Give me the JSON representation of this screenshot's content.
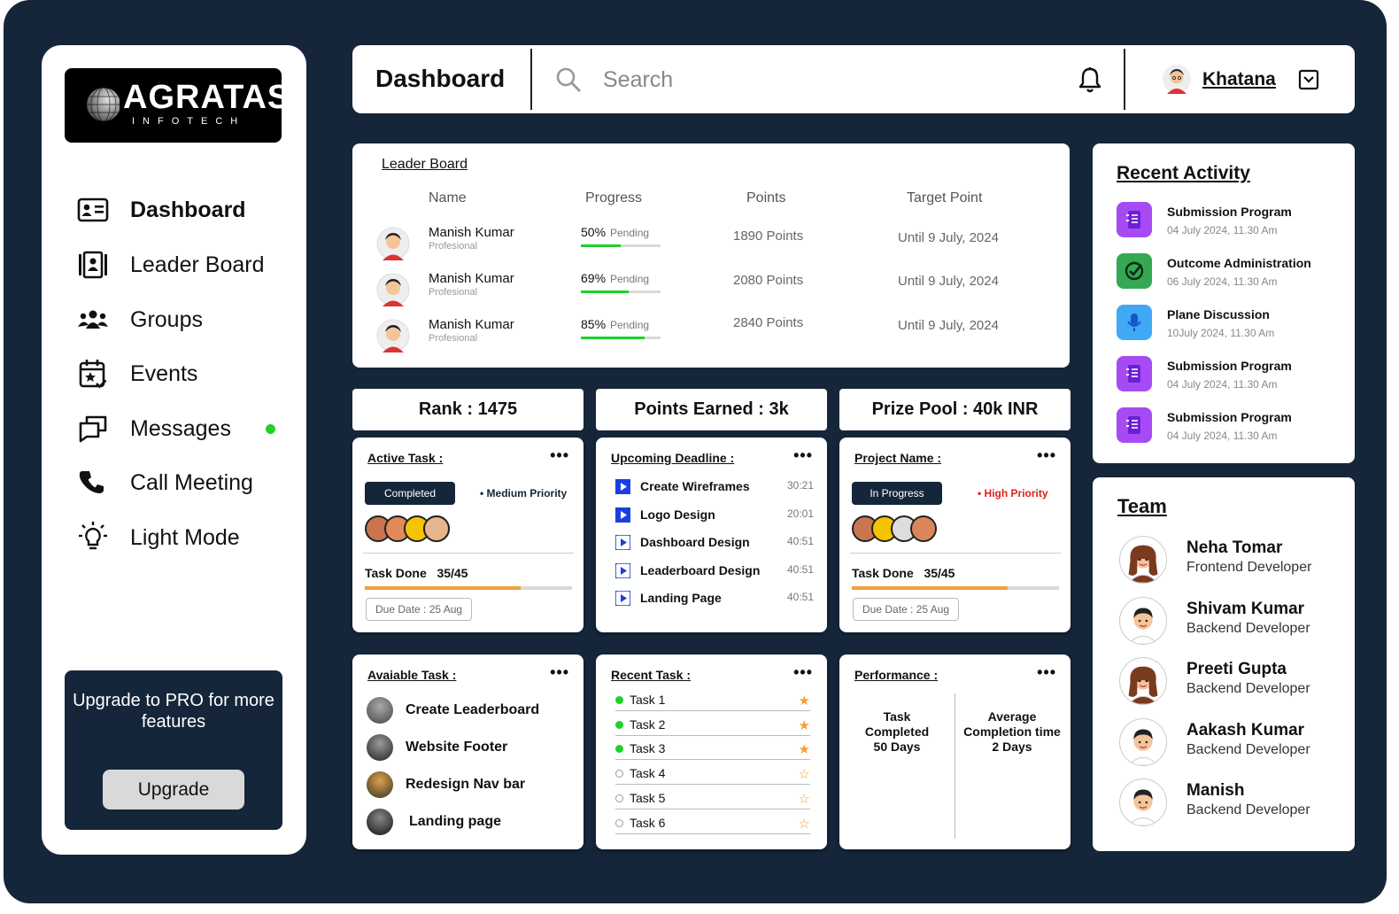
{
  "brand": {
    "name": "AGRATAS",
    "sub": "INFOTECH"
  },
  "nav": [
    {
      "label": "Dashboard",
      "icon": "id-card-icon",
      "active": true
    },
    {
      "label": "Leader Board",
      "icon": "contacts-icon"
    },
    {
      "label": "Groups",
      "icon": "group-icon"
    },
    {
      "label": "Events",
      "icon": "calendar-star-icon"
    },
    {
      "label": "Messages",
      "icon": "messages-icon",
      "dot": true
    },
    {
      "label": "Call Meeting",
      "icon": "phone-icon"
    },
    {
      "label": "Light Mode",
      "icon": "lightbulb-icon"
    }
  ],
  "upgrade": {
    "text": "Upgrade to PRO for more features",
    "button": "Upgrade"
  },
  "header": {
    "title": "Dashboard",
    "search_placeholder": "Search",
    "user": "Khatana"
  },
  "leaderboard": {
    "title": "Leader Board",
    "columns": [
      "Name",
      "Progress",
      "Points",
      "Target Point"
    ],
    "rows": [
      {
        "name": "Manish Kumar",
        "role": "Profesional",
        "pct": "50%",
        "pct_value": 0.5,
        "status": "Pending",
        "points": "1890 Points",
        "target": "Until 9 July, 2024"
      },
      {
        "name": "Manish Kumar",
        "role": "Profesional",
        "pct": "69%",
        "pct_value": 0.6,
        "status": "Pending",
        "points": "2080 Points",
        "target": "Until 9 July, 2024"
      },
      {
        "name": "Manish Kumar",
        "role": "Profesional",
        "pct": "85%",
        "pct_value": 0.8,
        "status": "Pending",
        "points": "2840 Points",
        "target": "Until 9 July, 2024"
      }
    ]
  },
  "stats": {
    "rank": "Rank : 1475",
    "points": "Points Earned : 3k",
    "prize": "Prize Pool : 40k INR"
  },
  "active_task": {
    "title": "Active Task :",
    "badge": "Completed",
    "priority": "Medium Priority",
    "task_done_label": "Task Done",
    "task_done": "35/45",
    "progress": 0.75,
    "due": "Due Date : 25 Aug"
  },
  "deadlines": {
    "title": "Upcoming Deadline :",
    "items": [
      {
        "name": "Create Wireframes",
        "time": "30:21"
      },
      {
        "name": "Logo Design",
        "time": "20:01"
      },
      {
        "name": "Dashboard Design",
        "time": "40:51"
      },
      {
        "name": "Leaderboard Design",
        "time": "40:51"
      },
      {
        "name": "Landing Page",
        "time": "40:51"
      }
    ]
  },
  "project": {
    "title": "Project Name :",
    "badge": "In Progress",
    "priority": "High Priority",
    "task_done_label": "Task Done",
    "task_done": "35/45",
    "progress": 0.75,
    "due": "Due Date : 25 Aug"
  },
  "available": {
    "title": "Avaiable Task :",
    "items": [
      "Create Leaderboard",
      "Website Footer",
      "Redesign Nav bar",
      "Landing page"
    ]
  },
  "recent_tasks": {
    "title": "Recent Task :",
    "items": [
      {
        "name": "Task 1",
        "done": true,
        "starred": true
      },
      {
        "name": "Task 2",
        "done": true,
        "starred": true
      },
      {
        "name": "Task 3",
        "done": true,
        "starred": true
      },
      {
        "name": "Task 4",
        "done": false,
        "starred": false
      },
      {
        "name": "Task 5",
        "done": false,
        "starred": false
      },
      {
        "name": "Task 6",
        "done": false,
        "starred": false
      }
    ]
  },
  "performance": {
    "title": "Performance :",
    "col1": [
      "Task",
      "Completed",
      "50 Days"
    ],
    "col2": [
      "Average",
      "Completion time",
      "2 Days"
    ]
  },
  "recent_activity": {
    "title": "Recent Activity",
    "items": [
      {
        "title": "Submission Program",
        "time": "04 July 2024, 11.30 Am",
        "icon": "notebook-icon",
        "color": "#a64bf4"
      },
      {
        "title": "Outcome Administration",
        "time": "06 July 2024, 11.30 Am",
        "icon": "check-circle-icon",
        "color": "#34a853"
      },
      {
        "title": "Plane Discussion",
        "time": "10July 2024, 11.30 Am",
        "icon": "microphone-icon",
        "color": "#3fa9f5"
      },
      {
        "title": "Submission Program",
        "time": "04 July 2024, 11.30 Am",
        "icon": "notebook-icon",
        "color": "#a64bf4"
      },
      {
        "title": "Submission Program",
        "time": "04 July 2024, 11.30 Am",
        "icon": "notebook-icon",
        "color": "#a64bf4"
      }
    ]
  },
  "team": {
    "title": "Team",
    "members": [
      {
        "name": "Neha Tomar",
        "role": "Frontend Developer",
        "gender": "f"
      },
      {
        "name": "Shivam Kumar",
        "role": "Backend Developer",
        "gender": "m"
      },
      {
        "name": "Preeti Gupta",
        "role": "Backend Developer",
        "gender": "f"
      },
      {
        "name": "Aakash Kumar",
        "role": "Backend Developer",
        "gender": "m"
      },
      {
        "name": "Manish",
        "role": "Backend Developer",
        "gender": "m"
      }
    ]
  },
  "colors": {
    "navy": "#15263a",
    "green": "#1ed12b",
    "orange": "#f2a03a",
    "blue": "#1a3fe0",
    "red": "#e0201a"
  }
}
